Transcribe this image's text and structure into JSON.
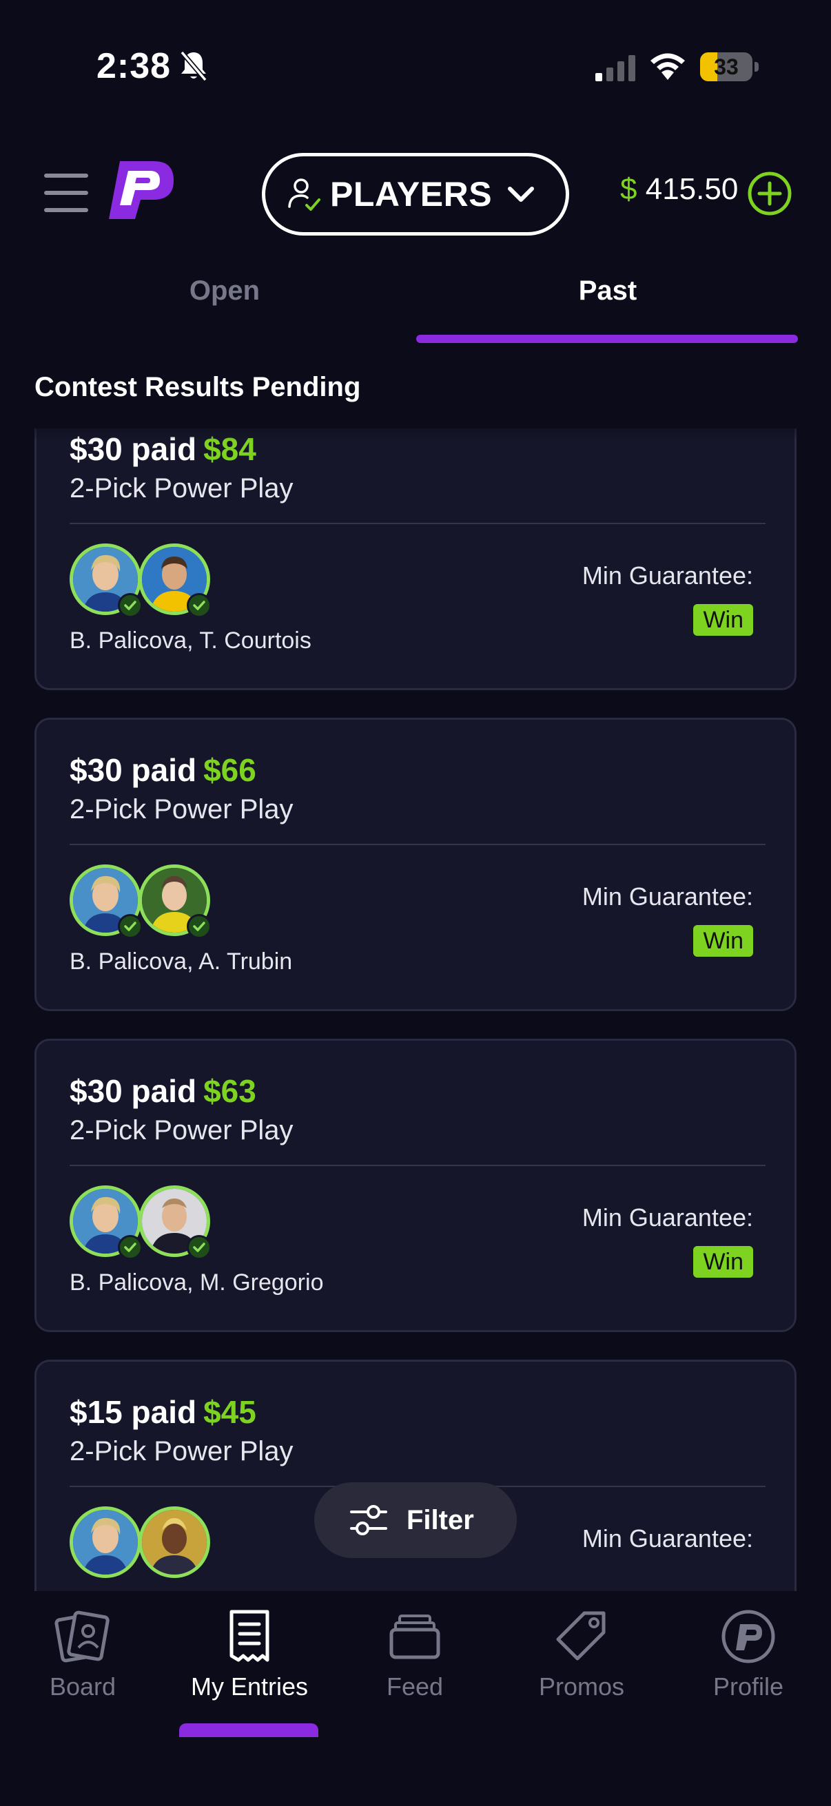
{
  "status_bar": {
    "time": "2:38",
    "battery_level": "33",
    "icons": [
      "bell-slash-icon",
      "cellular-signal-icon",
      "wifi-icon",
      "battery-icon"
    ]
  },
  "header": {
    "menu_icon": "hamburger-menu-icon",
    "logo_icon": "prizepicks-logo-icon",
    "mode_selector": {
      "label": "PLAYERS",
      "icon": "user-check-icon",
      "chevron": "chevron-down-icon"
    },
    "balance": {
      "currency_symbol": "$",
      "amount": "415.50"
    },
    "add_funds_icon": "plus-circle-icon"
  },
  "tabs": [
    {
      "label": "Open",
      "active": false
    },
    {
      "label": "Past",
      "active": true
    }
  ],
  "section_title": "Contest Results Pending",
  "entries": [
    {
      "paid": "$30 paid",
      "payout": "$84",
      "type": "2-Pick Power Play",
      "players": "B. Palicova, T. Courtois",
      "min_guarantee_label": "Min Guarantee:",
      "status": "Win"
    },
    {
      "paid": "$30 paid",
      "payout": "$66",
      "type": "2-Pick Power Play",
      "players": "B. Palicova, A. Trubin",
      "min_guarantee_label": "Min Guarantee:",
      "status": "Win"
    },
    {
      "paid": "$30 paid",
      "payout": "$63",
      "type": "2-Pick Power Play",
      "players": "B. Palicova, M. Gregorio",
      "min_guarantee_label": "Min Guarantee:",
      "status": "Win"
    },
    {
      "paid": "$15 paid",
      "payout": "$45",
      "type": "2-Pick Power Play",
      "players": "",
      "min_guarantee_label": "Min Guarantee:",
      "status": ""
    }
  ],
  "filter_button": {
    "label": "Filter",
    "icon": "sliders-icon"
  },
  "bottom_nav": [
    {
      "label": "Board",
      "icon": "board-cards-icon",
      "active": false
    },
    {
      "label": "My Entries",
      "icon": "receipt-icon",
      "active": true
    },
    {
      "label": "Feed",
      "icon": "inbox-tray-icon",
      "active": false
    },
    {
      "label": "Promos",
      "icon": "tag-icon",
      "active": false
    },
    {
      "label": "Profile",
      "icon": "profile-logo-icon",
      "active": false
    }
  ],
  "colors": {
    "background": "#0b0b1a",
    "card": "#16162a",
    "accent_green": "#7ed321",
    "accent_purple": "#8a2be2",
    "muted_text": "#77778a"
  }
}
